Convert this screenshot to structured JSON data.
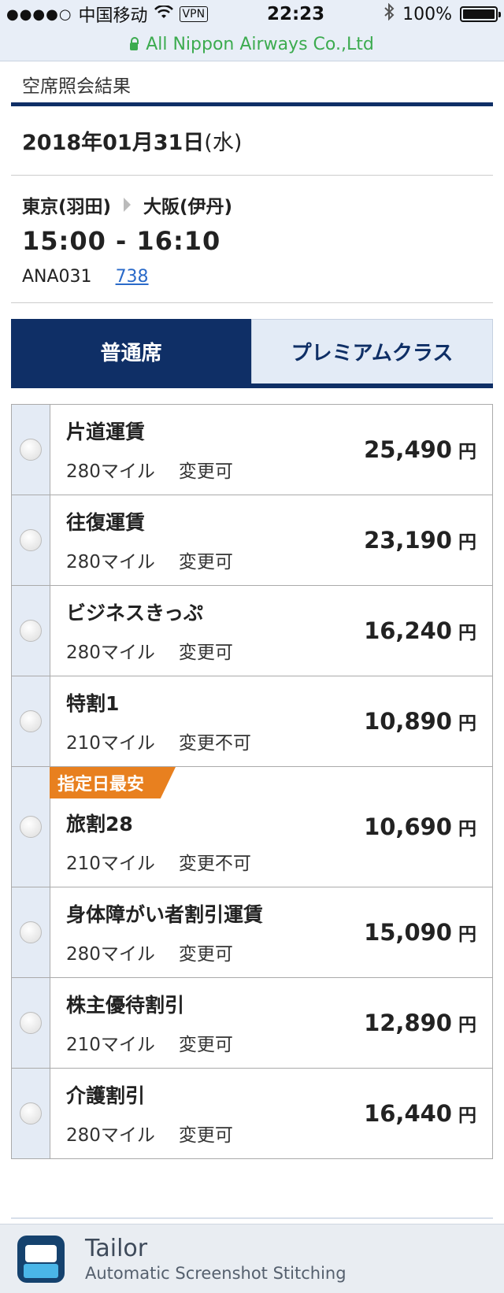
{
  "status_bar": {
    "signal_dots": "●●●●○",
    "carrier": "中国移动",
    "vpn": "VPN",
    "time": "22:23",
    "battery": "100%"
  },
  "browser": {
    "url_title": "All Nippon Airways Co.,Ltd"
  },
  "page": {
    "title": "空席照会結果"
  },
  "date": {
    "value": "2018年01月31日",
    "weekday": "(水)"
  },
  "flight": {
    "origin": "東京(羽田)",
    "destination": "大阪(伊丹)",
    "times": "15:00 - 16:10",
    "number": "ANA031",
    "aircraft": "738"
  },
  "tabs": [
    {
      "label": "普通席",
      "active": true
    },
    {
      "label": "プレミアムクラス",
      "active": false
    }
  ],
  "fares": [
    {
      "name": "片道運賃",
      "miles": "280マイル",
      "change": "変更可",
      "price": "25,490",
      "unit": "円",
      "badge": ""
    },
    {
      "name": "往復運賃",
      "miles": "280マイル",
      "change": "変更可",
      "price": "23,190",
      "unit": "円",
      "badge": ""
    },
    {
      "name": "ビジネスきっぷ",
      "miles": "280マイル",
      "change": "変更可",
      "price": "16,240",
      "unit": "円",
      "badge": ""
    },
    {
      "name": "特割1",
      "miles": "210マイル",
      "change": "変更不可",
      "price": "10,890",
      "unit": "円",
      "badge": ""
    },
    {
      "name": "旅割28",
      "miles": "210マイル",
      "change": "変更不可",
      "price": "10,690",
      "unit": "円",
      "badge": "指定日最安"
    },
    {
      "name": "身体障がい者割引運賃",
      "miles": "280マイル",
      "change": "変更可",
      "price": "15,090",
      "unit": "円",
      "badge": ""
    },
    {
      "name": "株主優待割引",
      "miles": "210マイル",
      "change": "変更可",
      "price": "12,890",
      "unit": "円",
      "badge": ""
    },
    {
      "name": "介護割引",
      "miles": "280マイル",
      "change": "変更可",
      "price": "16,440",
      "unit": "円",
      "badge": ""
    }
  ],
  "footer": {
    "app_name": "Tailor",
    "app_subtitle": "Automatic Screenshot Stitching"
  },
  "colors": {
    "brand_navy": "#0f2f66",
    "badge_orange": "#e8801f",
    "url_green": "#3cab4f",
    "link_blue": "#2a6ac9"
  }
}
